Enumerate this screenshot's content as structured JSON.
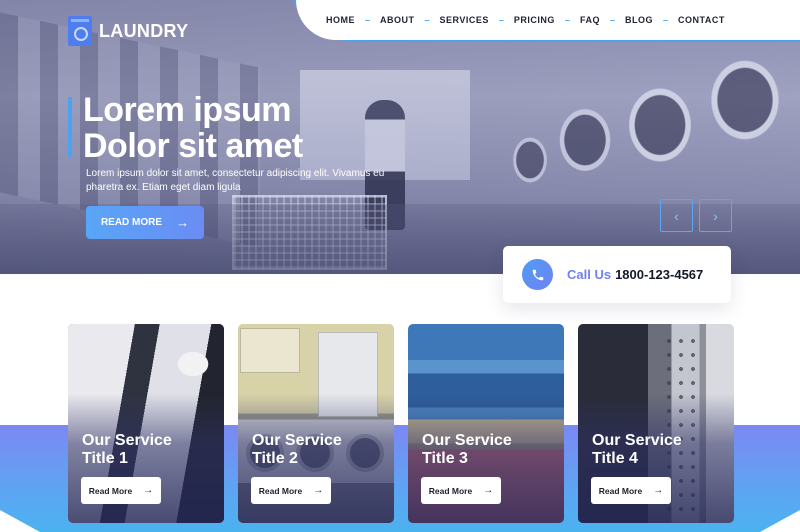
{
  "brand": {
    "name": "LAUNDRY",
    "logo_icon": "washing-machine-icon"
  },
  "nav": {
    "items": [
      {
        "label": "HOME"
      },
      {
        "label": "ABOUT"
      },
      {
        "label": "SERVICES"
      },
      {
        "label": "PRICING"
      },
      {
        "label": "FAQ"
      },
      {
        "label": "BLOG"
      },
      {
        "label": "CONTACT"
      }
    ],
    "separator": "–"
  },
  "hero": {
    "title_line1": "Lorem ipsum",
    "title_line2": "Dolor sit amet",
    "subtitle": "Lorem ipsum dolor sit amet, consectetur adipiscing elit. Vivamus eu pharetra ex. Etiam eget diam ligula",
    "cta_label": "READ MORE",
    "cta_icon": "→",
    "prev_icon": "‹",
    "next_icon": "›"
  },
  "contact": {
    "icon": "phone-icon",
    "label": "Call Us",
    "phone": "1800-123-4567"
  },
  "services": {
    "cards": [
      {
        "title_line1": "Our Service",
        "title_line2": "Title 1",
        "button_label": "Read More",
        "button_icon": "→"
      },
      {
        "title_line1": "Our Service",
        "title_line2": "Title 2",
        "button_label": "Read More",
        "button_icon": "→"
      },
      {
        "title_line1": "Our Service",
        "title_line2": "Title 3",
        "button_label": "Read More",
        "button_icon": "→"
      },
      {
        "title_line1": "Our Service",
        "title_line2": "Title 4",
        "button_label": "Read More",
        "button_icon": "→"
      }
    ]
  },
  "colors": {
    "accent_blue": "#4aa3f0",
    "accent_purple": "#6f82ee",
    "nav_text": "#1e2236",
    "band_top": "#7c88f3",
    "band_bottom": "#4bb2f0"
  }
}
